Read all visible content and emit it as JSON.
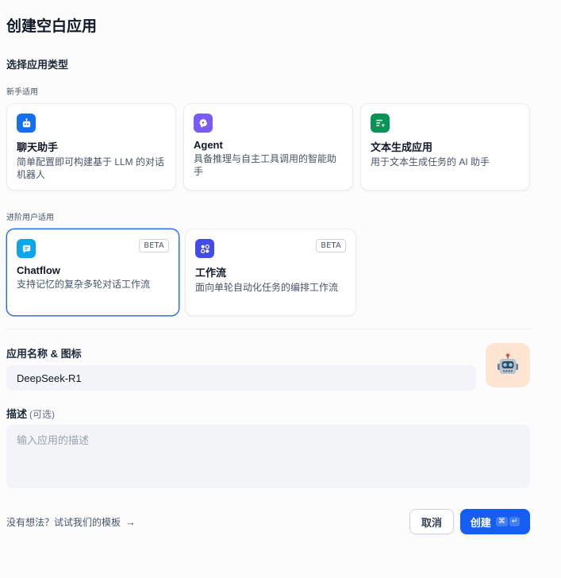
{
  "page_title": "创建空白应用",
  "section_title": "选择应用类型",
  "groups": {
    "beginner": "新手适用",
    "advanced": "进阶用户适用"
  },
  "cards": [
    {
      "title": "聊天助手",
      "desc": "简单配置即可构建基于 LLM 的对话机器人",
      "icon": "chat-bot-icon",
      "color": "#1570ef"
    },
    {
      "title": "Agent",
      "desc": "具备推理与自主工具调用的智能助手",
      "icon": "agent-icon",
      "color": "#7a5af8"
    },
    {
      "title": "文本生成应用",
      "desc": "用于文本生成任务的 AI 助手",
      "icon": "text-generation-icon",
      "color": "#079455"
    },
    {
      "title": "Chatflow",
      "desc": "支持记忆的复杂多轮对话工作流",
      "icon": "chatflow-icon",
      "color": "#0ba5ec",
      "badge": "BETA",
      "selected": true
    },
    {
      "title": "工作流",
      "desc": "面向单轮自动化任务的编排工作流",
      "icon": "workflow-icon",
      "color": "#444ce7",
      "badge": "BETA"
    }
  ],
  "form": {
    "name_label": "应用名称 & 图标",
    "name_value": "DeepSeek-R1",
    "avatar_icon": "robot-icon",
    "desc_label": "描述",
    "desc_optional": "(可选)",
    "desc_placeholder": "输入应用的描述"
  },
  "footer": {
    "template_link": "没有想法？试试我们的模板",
    "cancel": "取消",
    "create": "创建",
    "shortcut_keys": [
      "⌘",
      "↵"
    ]
  }
}
